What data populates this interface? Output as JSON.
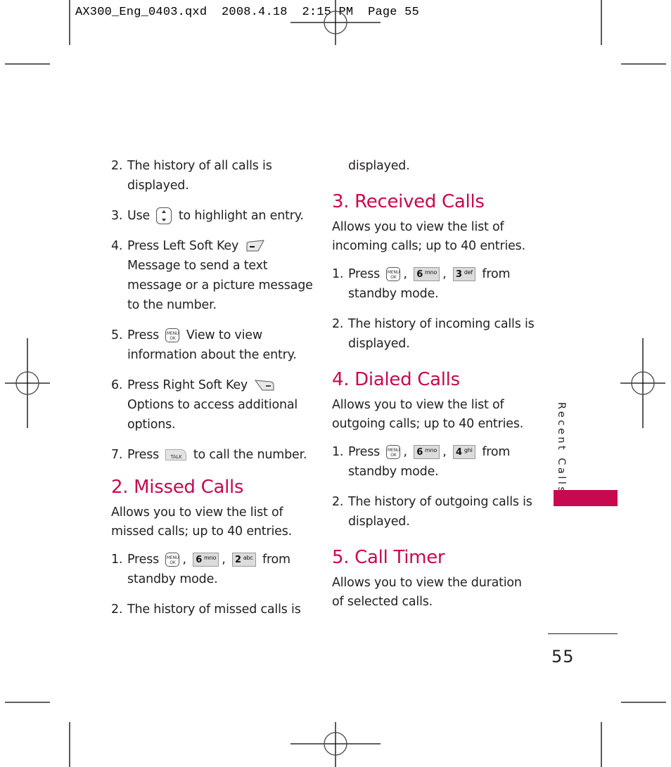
{
  "slug": {
    "text": "AX300_Eng_0403.qxd  2008.4.18  2:15 PM  Page 55"
  },
  "left_column": {
    "steps_top": [
      {
        "num": "2.",
        "text": "The history of all calls is displayed."
      },
      {
        "num": "3.",
        "pre": "Use",
        "icon": "navigation-key-icon",
        "post": "to highlight an entry."
      },
      {
        "num": "4.",
        "pre": "Press Left Soft Key",
        "icon": "left-soft-key-icon",
        "post": "Message to send a text message or a picture message to the number."
      },
      {
        "num": "5.",
        "pre": "Press",
        "icon": "menu-ok-key-icon",
        "post": "View  to view information about the entry."
      },
      {
        "num": "6.",
        "pre": "Press Right Soft Key",
        "icon": "right-soft-key-icon",
        "post": "Options to access additional options."
      },
      {
        "num": "7.",
        "pre": "Press",
        "icon": "talk-key-icon",
        "post": "to call the number."
      }
    ],
    "missed": {
      "heading": "2. Missed Calls",
      "desc": "Allows you to view the list of missed calls; up to 40 entries.",
      "step1": {
        "num": "1.",
        "pre": "Press",
        "keys": [
          "6",
          "2"
        ],
        "key_subs": [
          "mno",
          "abc"
        ],
        "post": "from standby mode."
      },
      "step2": {
        "num": "2.",
        "text": "The history of missed calls is"
      }
    }
  },
  "right_column": {
    "continued": "displayed.",
    "received": {
      "heading": "3. Received Calls",
      "desc": "Allows you to view the list of incoming calls; up to 40 entries.",
      "step1": {
        "num": "1.",
        "pre": "Press",
        "keys": [
          "6",
          "3"
        ],
        "key_subs": [
          "mno",
          "def"
        ],
        "post": "from standby mode."
      },
      "step2": {
        "num": "2.",
        "text": "The history of incoming calls is displayed."
      }
    },
    "dialed": {
      "heading": "4. Dialed Calls",
      "desc": "Allows you to view the list of outgoing calls; up to 40 entries.",
      "step1": {
        "num": "1.",
        "pre": "Press",
        "keys": [
          "6",
          "4"
        ],
        "key_subs": [
          "mno",
          "ghi"
        ],
        "post": "from standby mode."
      },
      "step2": {
        "num": "2.",
        "text": "The history of outgoing calls is displayed."
      }
    },
    "timer": {
      "heading": "5. Call Timer",
      "desc": "Allows you to view the duration of selected calls."
    }
  },
  "keys": {
    "menu_top": "MENU",
    "menu_bottom": "OK",
    "talk": "TALK",
    "comma": ","
  },
  "side_tab": {
    "label": "Recent Calls",
    "color": "#c8094f"
  },
  "folio": {
    "page_number": "55"
  },
  "colors": {
    "heading": "#c8094f",
    "body_text": "#231f20"
  }
}
